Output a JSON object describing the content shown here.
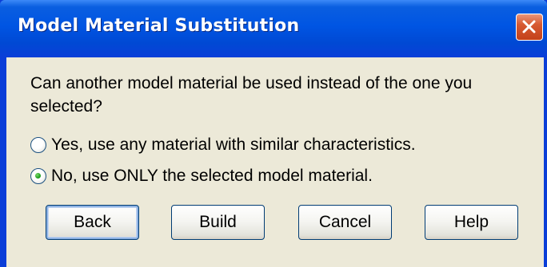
{
  "window": {
    "title": "Model Material Substitution",
    "close_icon": "close-icon"
  },
  "dialog": {
    "question": "Can another model material be used instead of the one you selected?",
    "options": [
      {
        "label": "Yes, use any material with similar characteristics.",
        "selected": false
      },
      {
        "label": "No, use ONLY the selected model material.",
        "selected": true
      }
    ]
  },
  "buttons": {
    "back": "Back",
    "build": "Build",
    "cancel": "Cancel",
    "help": "Help"
  },
  "colors": {
    "titlebar": "#0055e3",
    "dialog_bg": "#ece9d8",
    "close_button": "#d75a32",
    "radio_selected": "#21a121"
  }
}
